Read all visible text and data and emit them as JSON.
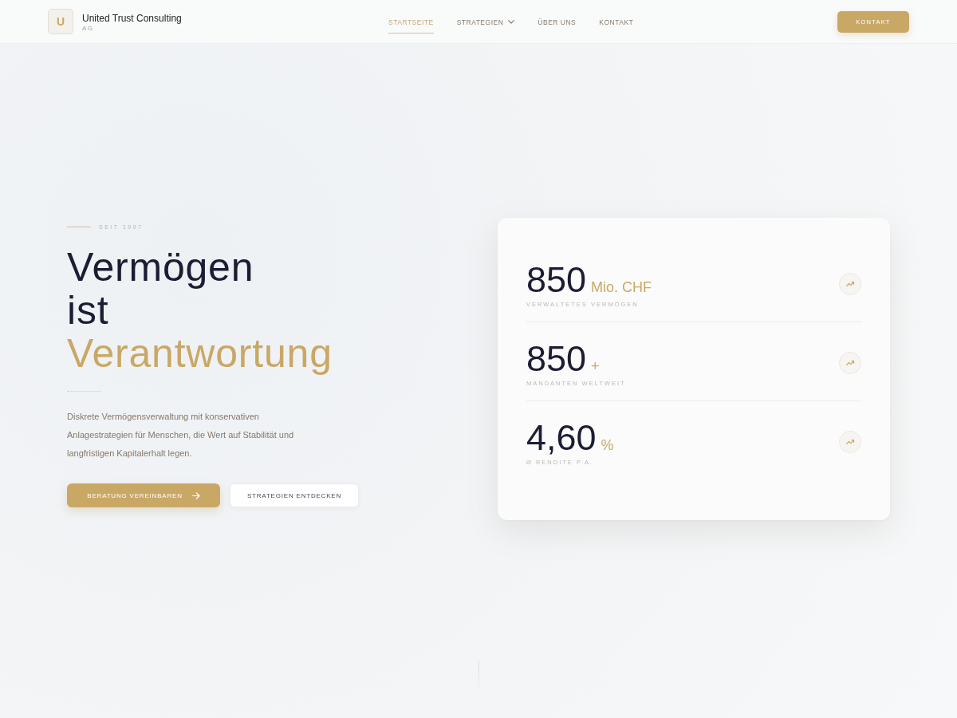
{
  "header": {
    "logo": {
      "letter": "U",
      "name": "United Trust Consulting",
      "suffix": "AG"
    },
    "nav": [
      {
        "label": "STARTSEITE",
        "selected": true,
        "dropdown": false
      },
      {
        "label": "STRATEGIEN",
        "selected": false,
        "dropdown": true
      },
      {
        "label": "ÜBER UNS",
        "selected": false,
        "dropdown": false
      },
      {
        "label": "KONTAKT",
        "selected": false,
        "dropdown": false
      }
    ],
    "cta": "KONTAKT"
  },
  "hero": {
    "eyebrow": "SEIT 1997",
    "heading": [
      {
        "text": "Vermögen",
        "accent": false
      },
      {
        "text": "ist",
        "accent": false
      },
      {
        "text": "Verantwortung",
        "accent": true
      }
    ],
    "description": "Diskrete Vermögensverwaltung mit konservativen Anlagestrategien für Menschen, die Wert auf Stabilität und langfristigen Kapitalerhalt legen.",
    "buttons": [
      {
        "label": "BERATUNG VEREINBAREN",
        "kind": "primary",
        "arrow": true
      },
      {
        "label": "STRATEGIEN ENTDECKEN",
        "kind": "secondary",
        "arrow": false
      }
    ]
  },
  "stats": [
    {
      "value": "850",
      "unit": "Mio. CHF",
      "label": "VERWALTETES VERMÖGEN"
    },
    {
      "value": "850",
      "unit": "+",
      "label": "MANDANTEN WELTWEIT"
    },
    {
      "value": "4,60",
      "unit": "%",
      "label": "Ø RENDITE P.A."
    }
  ]
}
